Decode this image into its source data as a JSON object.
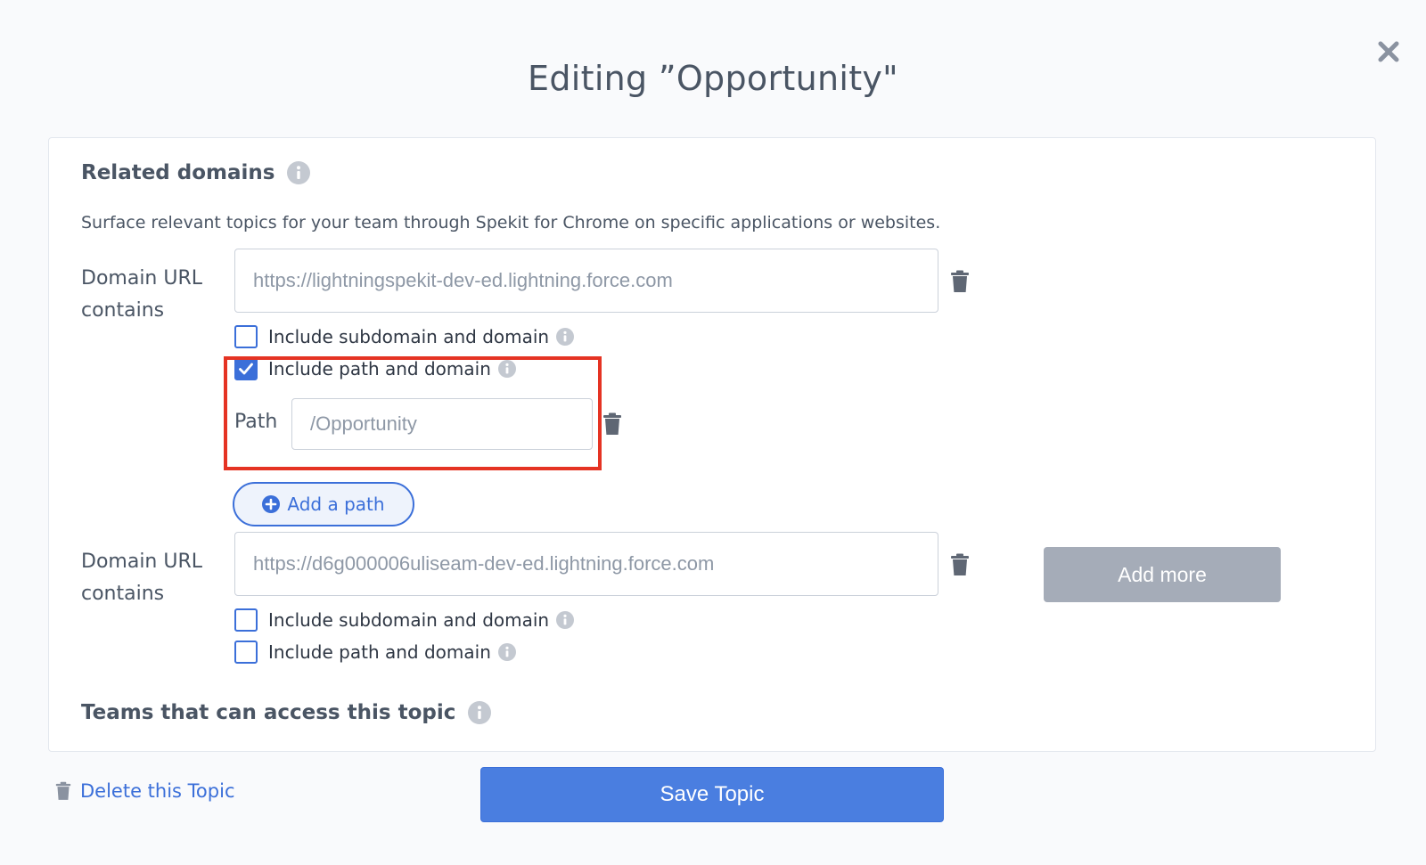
{
  "modal": {
    "title": "Editing ”Opportunity\"",
    "close_icon": "close-icon"
  },
  "related_domains": {
    "heading": "Related domains",
    "description": "Surface relevant topics for your team through Spekit for Chrome on specific applications or websites.",
    "domains": [
      {
        "label": "Domain URL contains",
        "url_value": "https://lightningspekit-dev-ed.lightning.force.com",
        "include_subdomain": {
          "label": "Include subdomain and domain",
          "checked": false
        },
        "include_path": {
          "label": "Include path and domain",
          "checked": true
        },
        "path": {
          "label": "Path",
          "value": "/Opportunity"
        },
        "add_path_label": "Add a path"
      },
      {
        "label": "Domain URL contains",
        "url_value": "https://d6g000006uliseam-dev-ed.lightning.force.com",
        "include_subdomain": {
          "label": "Include subdomain and domain",
          "checked": false
        },
        "include_path": {
          "label": "Include path and domain",
          "checked": false
        }
      }
    ],
    "add_more_label": "Add more"
  },
  "teams": {
    "heading": "Teams that can access this topic"
  },
  "footer": {
    "delete_label": "Delete this Topic",
    "save_label": "Save Topic"
  },
  "colors": {
    "accent": "#3b6fd9",
    "save_button": "#4a7ee0",
    "highlight": "#e53323",
    "disabled_button": "#a5acb8"
  }
}
